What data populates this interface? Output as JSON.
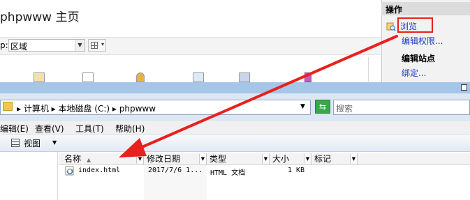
{
  "iis": {
    "title": "phpwww 主页",
    "filter_label": "p:",
    "group_value": "区域",
    "actions": {
      "header": "操作",
      "browse": "浏览",
      "edit_permissions": "编辑权限...",
      "edit_site_header": "编辑站点",
      "bindings": "绑定..."
    }
  },
  "explorer": {
    "address_path": "▸ 计算机 ▸ 本地磁盘 (C:) ▸ phpwww",
    "search_placeholder": "搜索",
    "menu": [
      "编辑(E)",
      "查看(V)",
      "工具(T)",
      "帮助(H)"
    ],
    "toolbar_view_label": "视图",
    "columns": [
      "名称",
      "修改日期",
      "类型",
      "大小",
      "标记"
    ],
    "files": [
      {
        "name": "index.html",
        "modified": "2017/7/6 1...",
        "type": "HTML 文档",
        "size": "1 KB",
        "tag": ""
      }
    ]
  },
  "colors": {
    "highlight": "#e8201e",
    "link": "#1a3cbf"
  }
}
